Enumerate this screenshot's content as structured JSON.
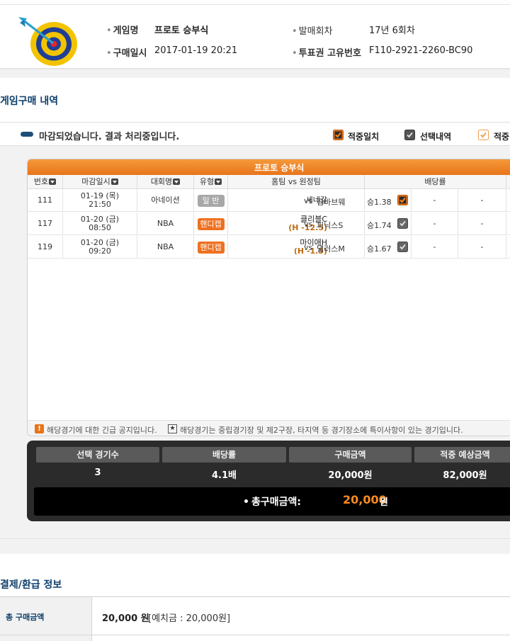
{
  "info": {
    "game_name_label": "게임명",
    "game_name": "프로토 승부식",
    "round_label": "발매회차",
    "round": "17년 6회차",
    "purchase_time_label": "구매일시",
    "purchase_time": "2017-01-19 20:21",
    "ticket_id_label": "투표권 고유번호",
    "ticket_id": "F110-2921-2260-BC90"
  },
  "purchase_history": {
    "section_title": "게임구매 내역",
    "status": "마감되었습니다. 결과 처리중입니다.",
    "legend": [
      {
        "label": "적중일치",
        "color": "#e8741a",
        "style": "filled-orange"
      },
      {
        "label": "선택내역",
        "color": "#555555",
        "style": "filled-gray"
      },
      {
        "label": "적중",
        "color": "#f0a050",
        "style": "outline-orange"
      }
    ],
    "card_title": "프로토 승부식",
    "columns": [
      "번호",
      "마감일시",
      "대회명",
      "유형",
      "홈팀 vs 원정팀",
      "배당률"
    ],
    "vs": "vs",
    "rows": [
      {
        "no": "111",
        "deadline_date": "01-19 (목)",
        "deadline_time": "21:50",
        "league": "아네이션",
        "type": "일 반",
        "type_style": "gray",
        "home": "세네갈",
        "handicap": "",
        "away": "짐바브웨",
        "odd": "승1.38",
        "check": "filled-orange",
        "other1": "-",
        "other2": "-"
      },
      {
        "no": "117",
        "deadline_date": "01-20 (금)",
        "deadline_time": "08:50",
        "league": "NBA",
        "type": "핸디캡",
        "type_style": "orange",
        "home": "클리블C",
        "handicap": "(H -12.5)",
        "away": "피닉스S",
        "odd": "승1.74",
        "check": "filled-gray",
        "other1": "-",
        "other2": "-"
      },
      {
        "no": "119",
        "deadline_date": "01-20 (금)",
        "deadline_time": "09:20",
        "league": "NBA",
        "type": "핸디캡",
        "type_style": "orange",
        "home": "마이애H",
        "handicap": "(H -1.5)",
        "away": "댈러스M",
        "odd": "승1.67",
        "check": "filled-gray",
        "other1": "-",
        "other2": "-"
      }
    ],
    "notice_urgent": "해당경기에 대한 긴급 공지입니다.",
    "notice_star_icon": "★",
    "notice_neutral": "해당경기는 중립경기장 및 제2구장, 타지역 등 경기장소에 특이사항이 있는 경기입니다."
  },
  "summary": {
    "headers": [
      "선택 경기수",
      "배당률",
      "구매금액",
      "적중 예상금액"
    ],
    "values": [
      "3",
      "4.1배",
      "20,000원",
      "82,000원"
    ],
    "total_label": "총구매금액:",
    "total_value": "20,000",
    "total_unit": "원"
  },
  "payment": {
    "section_title": "결제/환급 정보",
    "total_purchase_label": "총 구매금액",
    "total_purchase_value": "20,000 원",
    "deposit_detail": "[예치금 : 20,000원]"
  }
}
